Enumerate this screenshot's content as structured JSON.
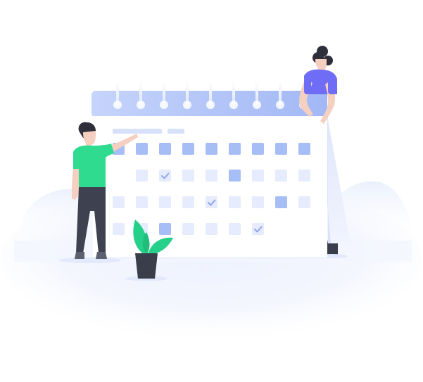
{
  "scene": {
    "name": "calendar-planning-illustration"
  },
  "calendar": {
    "grid": [
      [
        "dark",
        "dark",
        "dark",
        "dark",
        "dark",
        "dark",
        "dark",
        "dark",
        "dark"
      ],
      [
        "empty",
        "light",
        "check",
        "light",
        "light",
        "dark",
        "light",
        "light",
        "light"
      ],
      [
        "light",
        "light",
        "light",
        "light",
        "check",
        "light",
        "light",
        "dark",
        "light"
      ],
      [
        "light",
        "light",
        "dark",
        "light",
        "light",
        "light",
        "check",
        "empty",
        "empty"
      ]
    ],
    "colors": {
      "header": "#a9bff7",
      "header_light": "#c9d6fb",
      "day_dark": "#a7bdf6",
      "day_light": "#e6ecfd",
      "check": "#8da6ee",
      "page": "#ffffff",
      "page_back": "#e9eefc"
    }
  },
  "people": {
    "pointing_man": {
      "shirt_color": "#2fdb8f",
      "pants_color": "#3d4150"
    },
    "holding_woman": {
      "shirt_color": "#6f6cf5",
      "hair_color": "#2e2f3a"
    }
  },
  "plants": {
    "leaf_color": "#25d18a",
    "leaf_dark": "#1fbf7b",
    "pot_color": "#3a3d4a"
  }
}
